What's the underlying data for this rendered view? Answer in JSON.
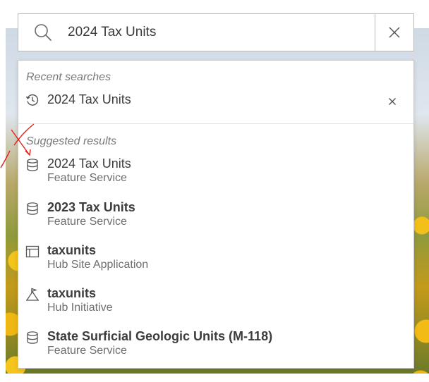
{
  "search": {
    "query": "2024 Tax Units"
  },
  "recent": {
    "heading": "Recent searches",
    "items": [
      {
        "label": "2024 Tax Units"
      }
    ]
  },
  "suggested": {
    "heading": "Suggested results",
    "items": [
      {
        "title": "2024 Tax Units",
        "type": "Feature Service",
        "icon": "database-icon",
        "bold": false
      },
      {
        "title": "2023 Tax Units",
        "type": "Feature Service",
        "icon": "database-icon",
        "bold": true
      },
      {
        "title": "taxunits",
        "type": "Hub Site Application",
        "icon": "layout-icon",
        "bold": true
      },
      {
        "title": "taxunits",
        "type": "Hub Initiative",
        "icon": "flag-icon",
        "bold": true
      },
      {
        "title": "State Surficial Geologic Units (M-118)",
        "type": "Feature Service",
        "icon": "database-icon",
        "bold": true
      }
    ]
  },
  "colors": {
    "annotation": "#e0211b",
    "icon": "#5a5a5a"
  }
}
